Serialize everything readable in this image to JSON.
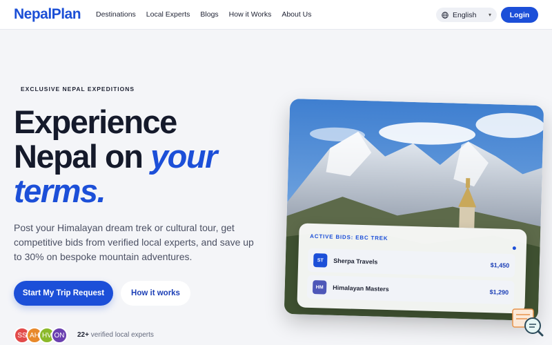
{
  "brand": {
    "name": "NepalPlan"
  },
  "nav": {
    "links": [
      "Destinations",
      "Local Experts",
      "Blogs",
      "How it Works",
      "About Us"
    ],
    "language": "English",
    "login_label": "Login"
  },
  "hero": {
    "eyebrow": "EXCLUSIVE NEPAL EXPEDITIONS",
    "headline_line1": "Experience",
    "headline_line2": "Nepal on ",
    "headline_accent1": "your",
    "headline_accent2": "terms",
    "headline_period": ".",
    "subtext": "Post your Himalayan dream trek or cultural tour, get competitive bids from verified local experts, and save up to 30% on bespoke mountain adventures.",
    "primary_cta": "Start My Trip Request",
    "secondary_cta": "How it works",
    "avatars": [
      {
        "initials": "SS",
        "color": "#e24a4a"
      },
      {
        "initials": "AH",
        "color": "#e8892b"
      },
      {
        "initials": "HV",
        "color": "#8bb92a"
      },
      {
        "initials": "ON",
        "color": "#6a3fb0"
      }
    ],
    "experts_count": "22+",
    "experts_text": " verified local experts"
  },
  "bids_card": {
    "title": "ACTIVE BIDS: EBC TREK",
    "rows": [
      {
        "badge": "ST",
        "badge_color": "#1c4fd8",
        "name": "Sherpa Travels",
        "amount": "$1,450"
      },
      {
        "badge": "HM",
        "badge_color": "#4e57b8",
        "name": "Himalayan Masters",
        "amount": "$1,290"
      }
    ]
  },
  "icons": {
    "language": "globe-icon",
    "dropdown": "chevron-down-icon",
    "chat": "chat-search-icon"
  },
  "colors": {
    "accent": "#1c4fd8",
    "text": "#151a2b",
    "background": "#f4f5f8"
  }
}
